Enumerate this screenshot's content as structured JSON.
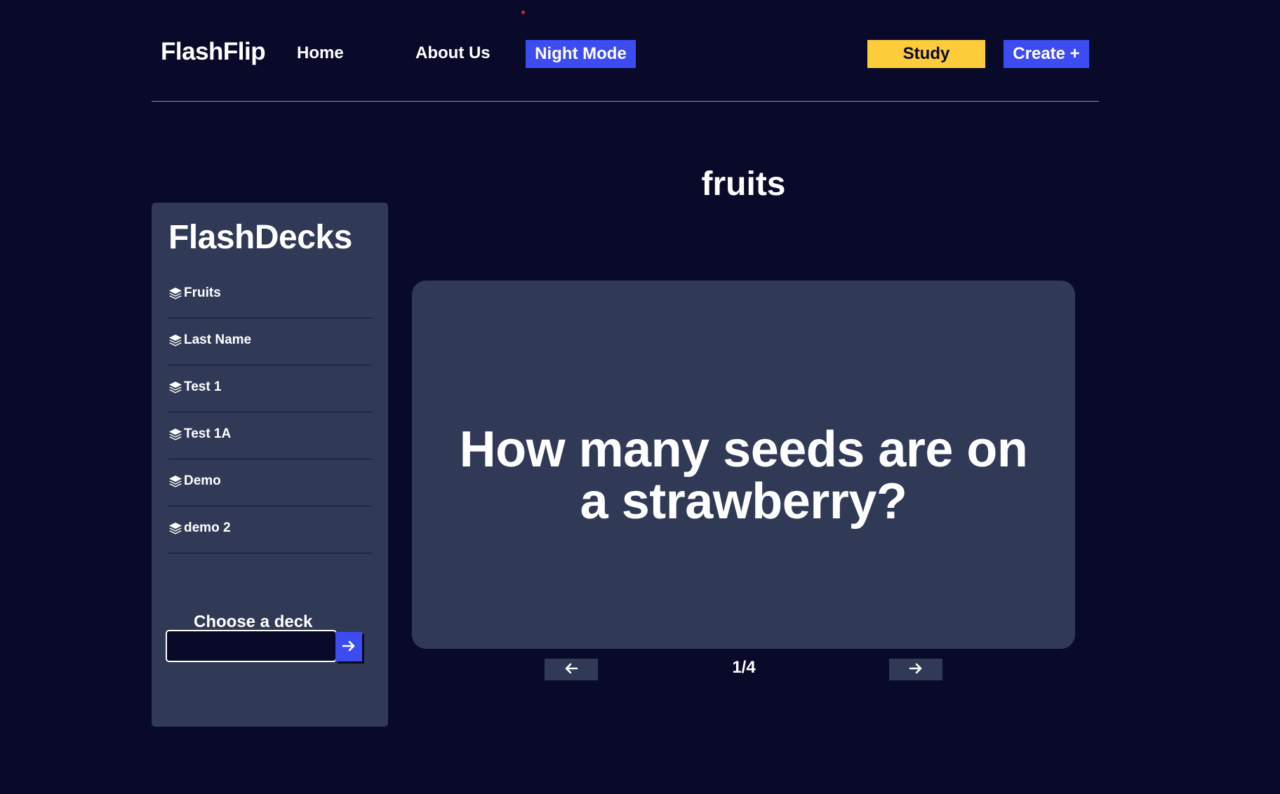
{
  "header": {
    "brand": "FlashFlip",
    "nav": {
      "home": "Home",
      "about": "About Us"
    },
    "night_mode_label": "Night Mode",
    "study_label": "Study",
    "create_label": "Create +"
  },
  "sidebar": {
    "title": "FlashDecks",
    "decks": [
      {
        "label": "Fruits"
      },
      {
        "label": "Last Name"
      },
      {
        "label": "Test 1"
      },
      {
        "label": "Test 1A"
      },
      {
        "label": "Demo"
      },
      {
        "label": "demo 2"
      }
    ],
    "choose_label": "Choose a deck",
    "input_value": "",
    "deck_icon": "layer-group-icon",
    "go_icon": "arrow-right-icon"
  },
  "main": {
    "deck_title": "fruits",
    "card_text": "How many seeds are on a strawberry?",
    "counter": "1/4",
    "prev_icon": "arrow-left-icon",
    "next_icon": "arrow-right-icon"
  },
  "colors": {
    "background": "#090a2a",
    "panel": "#303a56",
    "accent_blue": "#3d4cf0",
    "accent_yellow": "#fccc3a"
  }
}
